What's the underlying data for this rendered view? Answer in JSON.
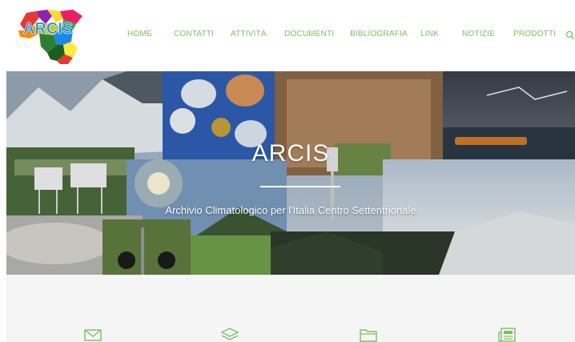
{
  "header": {
    "logo_text": "ARCIS",
    "nav": [
      {
        "label": "HOME"
      },
      {
        "label": "CONTATTI"
      },
      {
        "label": "ATTIVITÀ"
      },
      {
        "label": "DOCUMENTI"
      },
      {
        "label": "BIBLIOGRAFIA"
      },
      {
        "label": "LINK"
      },
      {
        "label": "NOTIZIE"
      },
      {
        "label": "PRODOTTI"
      }
    ],
    "search_icon": "search-icon"
  },
  "hero": {
    "title": "ARCIS",
    "subtitle": "Archivio Climatologico per l'Italia Centro Settentrionale"
  },
  "features": [
    {
      "icon": "envelope-icon"
    },
    {
      "icon": "layers-icon"
    },
    {
      "icon": "folder-icon"
    },
    {
      "icon": "newspaper-icon"
    }
  ],
  "colors": {
    "accent": "#7cbf62",
    "section_bg": "#f5f5f5"
  }
}
